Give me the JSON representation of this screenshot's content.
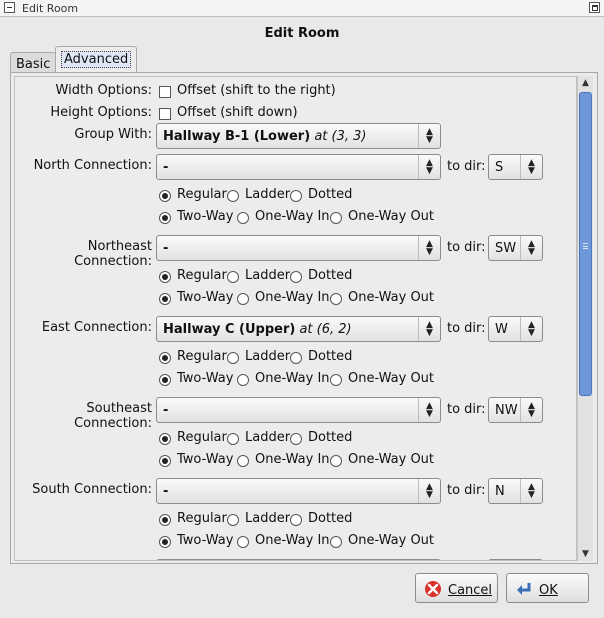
{
  "window": {
    "title": "Edit Room"
  },
  "dialog": {
    "title": "Edit Room"
  },
  "tabs": [
    {
      "label": "Basic"
    },
    {
      "label": "Advanced"
    }
  ],
  "width_options": {
    "label": "Width Options:",
    "check_label": "Offset (shift to the right)",
    "checked": false
  },
  "height_options": {
    "label": "Height Options:",
    "check_label": "Offset (shift down)",
    "checked": false
  },
  "group_with": {
    "label": "Group With:",
    "room": "Hallway B-1 (Lower)",
    "coords": "at (3, 3)"
  },
  "to_dir_label": "to dir:",
  "radio_labels": {
    "regular": "Regular",
    "ladder": "Ladder",
    "dotted": "Dotted",
    "two_way": "Two-Way",
    "one_way_in": "One-Way In",
    "one_way_out": "One-Way Out"
  },
  "connections": [
    {
      "label": "North Connection:",
      "room": "-",
      "coords": "",
      "dir": "S"
    },
    {
      "label": "Northeast Connection:",
      "room": "-",
      "coords": "",
      "dir": "SW"
    },
    {
      "label": "East Connection:",
      "room": "Hallway C (Upper)",
      "coords": "at (6, 2)",
      "dir": "W"
    },
    {
      "label": "Southeast Connection:",
      "room": "-",
      "coords": "",
      "dir": "NW"
    },
    {
      "label": "South Connection:",
      "room": "-",
      "coords": "",
      "dir": "N"
    }
  ],
  "buttons": {
    "cancel": "Cancel",
    "ok": "OK"
  },
  "colors": {
    "scroll_thumb": "#6f98d8",
    "cancel_icon": "#d8322a",
    "ok_icon": "#3a6fb8"
  }
}
